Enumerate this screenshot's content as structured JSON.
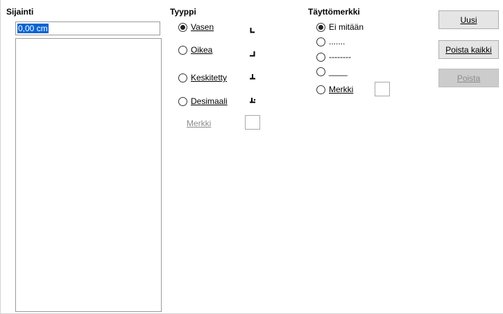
{
  "position": {
    "heading": "Sijainti",
    "input_value": "0,00 cm",
    "list_items": []
  },
  "type": {
    "heading": "Tyyppi",
    "options": [
      {
        "label": "Vasen",
        "checked": true,
        "icon": "tab-left-icon"
      },
      {
        "label": "Oikea",
        "checked": false,
        "icon": "tab-right-icon"
      },
      {
        "label": "Keskitetty",
        "checked": false,
        "icon": "tab-center-icon"
      },
      {
        "label": "Desimaali",
        "checked": false,
        "icon": "tab-decimal-icon"
      }
    ],
    "char_label": "Merkki",
    "char_value": ""
  },
  "fill": {
    "heading": "Täyttömerkki",
    "options": [
      {
        "label": "Ei mitään",
        "checked": true
      },
      {
        "label": ".......",
        "checked": false
      },
      {
        "label": "--------",
        "checked": false
      },
      {
        "label": "____",
        "checked": false
      },
      {
        "label": "Merkki",
        "checked": false
      }
    ],
    "char_value": ""
  },
  "buttons": {
    "new_label": "Uusi",
    "delete_all_label": "Poista kaikki",
    "delete_label": "Poista"
  }
}
